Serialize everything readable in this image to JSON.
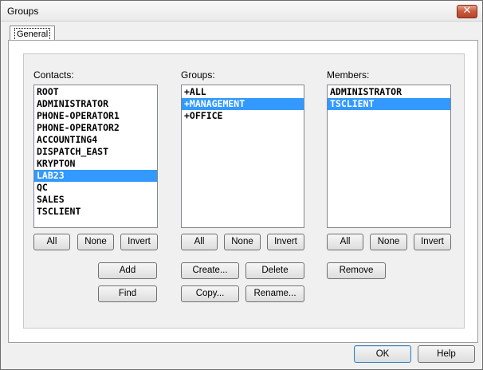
{
  "window": {
    "title": "Groups",
    "close_label": "✕"
  },
  "tabs": [
    {
      "label": "General"
    }
  ],
  "contacts": {
    "label": "Contacts:",
    "items": [
      "ROOT",
      "ADMINISTRATOR",
      "PHONE-OPERATOR1",
      "PHONE-OPERATOR2",
      "ACCOUNTING4",
      "DISPATCH_EAST",
      "KRYPTON",
      "LAB23",
      "QC",
      "SALES",
      "TSCLIENT"
    ],
    "selected": "LAB23",
    "buttons": {
      "all": "All",
      "none": "None",
      "invert": "Invert",
      "add": "Add",
      "find": "Find"
    }
  },
  "groups": {
    "label": "Groups:",
    "items": [
      "+ALL",
      "+MANAGEMENT",
      "+OFFICE"
    ],
    "selected": "+MANAGEMENT",
    "buttons": {
      "all": "All",
      "none": "None",
      "invert": "Invert",
      "create": "Create...",
      "delete": "Delete",
      "copy": "Copy...",
      "rename": "Rename..."
    }
  },
  "members": {
    "label": "Members:",
    "items": [
      "ADMINISTRATOR",
      "TSCLIENT"
    ],
    "selected": "TSCLIENT",
    "buttons": {
      "all": "All",
      "none": "None",
      "invert": "Invert",
      "remove": "Remove"
    }
  },
  "footer": {
    "ok_label": "OK",
    "help_label": "Help"
  },
  "colors": {
    "selection": "#3399ff",
    "close_button": "#c75a3c"
  },
  "icons": {
    "close": "close-icon"
  }
}
